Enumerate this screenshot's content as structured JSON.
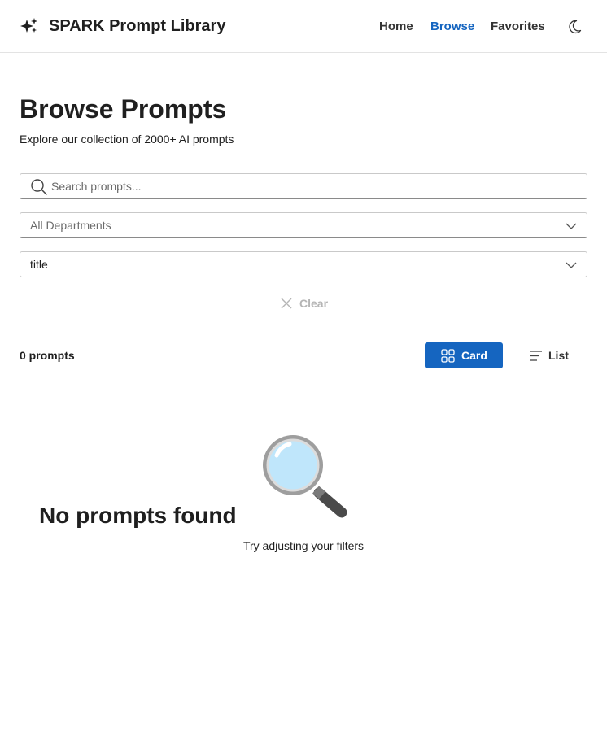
{
  "header": {
    "app_title": "SPARK Prompt Library",
    "logo_icon": "sparkle-icon",
    "nav": {
      "home": "Home",
      "browse": "Browse",
      "favorites": "Favorites"
    },
    "active_nav": "Browse",
    "theme_icon": "moon-icon"
  },
  "main": {
    "title": "Browse Prompts",
    "subtitle": "Explore our collection of 2000+ AI prompts"
  },
  "filters": {
    "search": {
      "placeholder": "Search prompts...",
      "value": "",
      "icon": "search-icon"
    },
    "department": {
      "value": "All Departments",
      "icon": "chevron-down-icon"
    },
    "sort": {
      "value": "title",
      "icon": "chevron-down-icon"
    },
    "clear_label": "Clear"
  },
  "results": {
    "count_label": "0 prompts",
    "view_card_label": "Card",
    "view_list_label": "List",
    "active_view": "Card"
  },
  "empty_state": {
    "icon": "magnifying-glass-icon",
    "title": "No prompts found",
    "subtitle": "Try adjusting your filters"
  },
  "colors": {
    "accent": "#1565c0",
    "text": "#1f1f1f",
    "muted": "#6b6b6b",
    "disabled": "#b5b5b5",
    "border": "#e3e3e3"
  }
}
